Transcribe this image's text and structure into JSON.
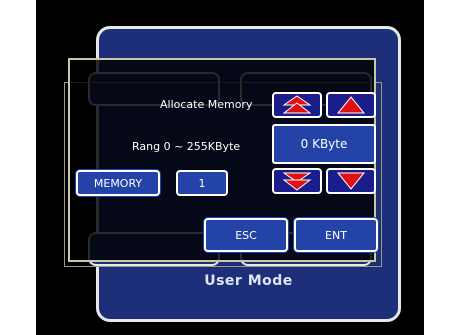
{
  "background": {
    "title": "User Mode"
  },
  "dialog": {
    "heading": "Allocate Memory",
    "range_label": "Rang 0 ~ 255KByte",
    "value_display": "0 KByte",
    "memory_button": "MEMORY",
    "memory_index": "1",
    "esc_button": "ESC",
    "ent_button": "ENT"
  },
  "colors": {
    "button_fill": "#2443a8",
    "arrow_fill": "#1a1d8a",
    "arrow_glyph": "#e01010",
    "panel_fill": "#1d2f78"
  },
  "icons": {
    "fast_up": "double-up-arrow-icon",
    "up": "up-arrow-icon",
    "fast_down": "double-down-arrow-icon",
    "down": "down-arrow-icon"
  }
}
